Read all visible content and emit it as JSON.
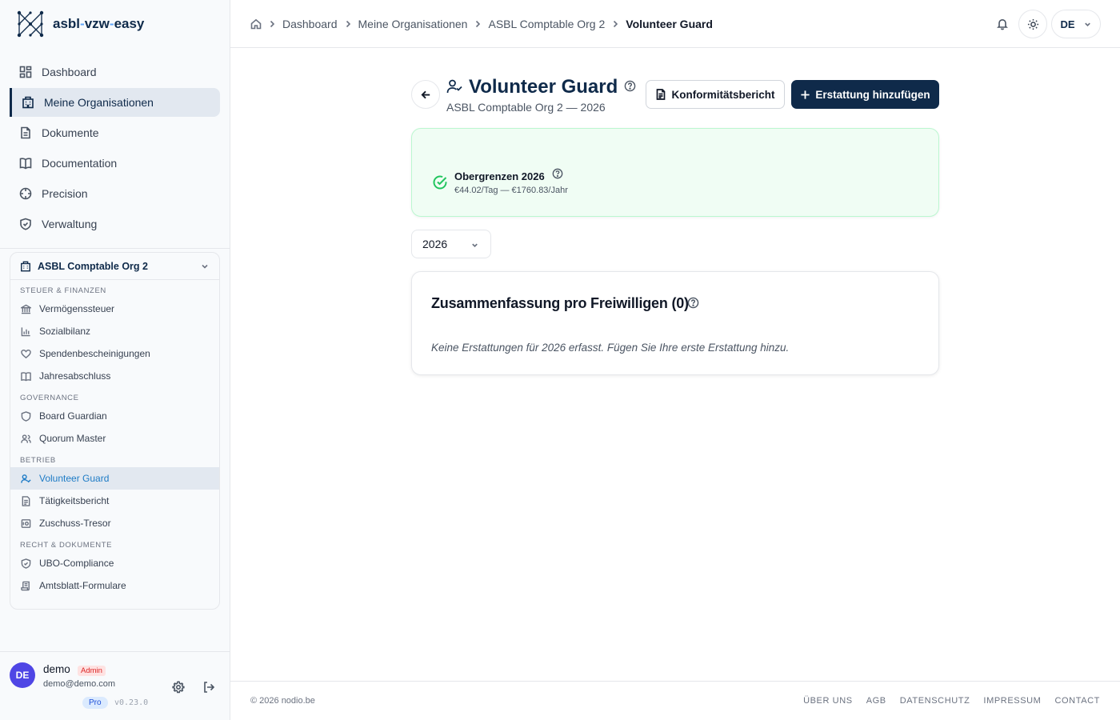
{
  "brand": {
    "name_part1": "asbl",
    "name_dash1": "-",
    "name_part2": "vzw",
    "name_dash2": "-",
    "name_part3": "easy"
  },
  "nav": {
    "items": [
      {
        "label": "Dashboard",
        "icon": "grid-icon"
      },
      {
        "label": "Meine Organisationen",
        "icon": "building-icon",
        "active": true
      },
      {
        "label": "Dokumente",
        "icon": "document-icon"
      },
      {
        "label": "Documentation",
        "icon": "book-icon"
      },
      {
        "label": "Precision",
        "icon": "crosshair-icon"
      },
      {
        "label": "Verwaltung",
        "icon": "shield-icon"
      }
    ]
  },
  "org": {
    "name": "ASBL Comptable Org 2",
    "sections": [
      {
        "title": "STEUER & FINANZEN",
        "items": [
          "Vermögenssteuer",
          "Sozialbilanz",
          "Spendenbescheinigungen",
          "Jahresabschluss"
        ]
      },
      {
        "title": "GOVERNANCE",
        "items": [
          "Board Guardian",
          "Quorum Master"
        ]
      },
      {
        "title": "BETRIEB",
        "items": [
          "Volunteer Guard",
          "Tätigkeitsbericht",
          "Zuschuss-Tresor"
        ]
      },
      {
        "title": "RECHT & DOKUMENTE",
        "items": [
          "UBO-Compliance",
          "Amtsblatt-Formulare"
        ]
      }
    ],
    "active_item": "Volunteer Guard"
  },
  "user": {
    "initials": "DE",
    "name": "demo",
    "role_badge": "Admin",
    "email": "demo@demo.com",
    "plan": "Pro",
    "version": "v0.23.0"
  },
  "header": {
    "breadcrumbs": [
      "Dashboard",
      "Meine Organisationen",
      "ASBL Comptable Org 2"
    ],
    "current": "Volunteer Guard",
    "language": "DE"
  },
  "page": {
    "title": "Volunteer Guard",
    "subtitle": "ASBL Comptable Org 2 — 2026",
    "report_button": "Konformitätsbericht",
    "add_button": "Erstattung hinzufügen"
  },
  "limits": {
    "title": "Obergrenzen 2026",
    "values": "€44.02/Tag — €1760.83/Jahr",
    "status_color": "#22c55e"
  },
  "year_select": {
    "value": "2026"
  },
  "summary": {
    "title": "Zusammenfassung pro Freiwilligen (0)",
    "empty_text": "Keine Erstattungen für 2026 erfasst. Fügen Sie Ihre erste Erstattung hinzu."
  },
  "footer": {
    "copyright": "© 2026 nodio.be",
    "links": [
      "ÜBER UNS",
      "AGB",
      "DATENSCHUTZ",
      "IMPRESSUM",
      "CONTACT"
    ]
  },
  "colors": {
    "brand": "#0f2a4a",
    "accent_active": "#1d7bc6",
    "success": "#22c55e"
  }
}
